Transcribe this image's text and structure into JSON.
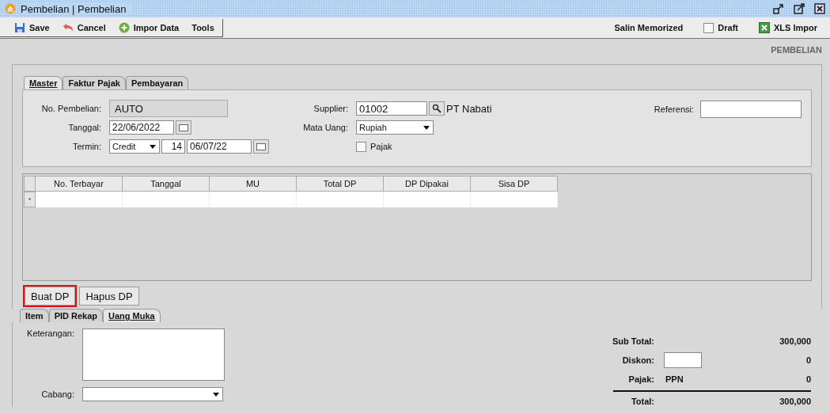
{
  "window": {
    "title": "Pembelian | Pembelian"
  },
  "toolbar": {
    "left": [
      {
        "label": "Save"
      },
      {
        "label": "Cancel"
      },
      {
        "label": "Impor Data"
      },
      {
        "label": "Tools"
      }
    ],
    "copy_memorized": "Salin Memorized",
    "draft": {
      "label": "Draft",
      "checked": false
    },
    "xls_import": "XLS Impor"
  },
  "form_title": "PEMBELIAN",
  "top_tabs": [
    {
      "label": "Master",
      "selected": true
    },
    {
      "label": "Faktur Pajak",
      "selected": false
    },
    {
      "label": "Pembayaran",
      "selected": false
    }
  ],
  "master": {
    "no_pembelian": {
      "label": "No. Pembelian:",
      "value": "AUTO"
    },
    "tanggal": {
      "label": "Tanggal:",
      "value": "22/06/2022"
    },
    "termin": {
      "label": "Termin:",
      "type": "Credit",
      "days": "14",
      "due": "06/07/22"
    },
    "supplier": {
      "label": "Supplier:",
      "code": "01002",
      "name": "PT Nabati"
    },
    "mata_uang": {
      "label": "Mata Uang:",
      "value": "Rupiah"
    },
    "pajak": {
      "label": "Pajak",
      "checked": false
    },
    "referensi": {
      "label": "Referensi:"
    }
  },
  "table": {
    "columns": [
      "No. Terbayar",
      "Tanggal",
      "MU",
      "Total DP",
      "DP Dipakai",
      "Sisa DP"
    ],
    "new_row_marker": "*"
  },
  "buttons": [
    {
      "label": "Buat DP",
      "highlighted": true
    },
    {
      "label": "Hapus DP",
      "highlighted": false
    }
  ],
  "bottom_tabs": [
    {
      "label": "Item",
      "selected": false
    },
    {
      "label": "PID Rekap",
      "selected": false
    },
    {
      "label": "Uang Muka",
      "selected": true
    }
  ],
  "keterangan": {
    "label": "Keterangan:"
  },
  "cabang": {
    "label": "Cabang:"
  },
  "totals": {
    "sub_total": {
      "label": "Sub Total:",
      "value": "300,000"
    },
    "diskon": {
      "label": "Diskon:",
      "value": "0"
    },
    "pajak": {
      "label": "Pajak:",
      "type": "PPN",
      "value": "0"
    },
    "total": {
      "label": "Total:",
      "value": "300,000"
    }
  }
}
